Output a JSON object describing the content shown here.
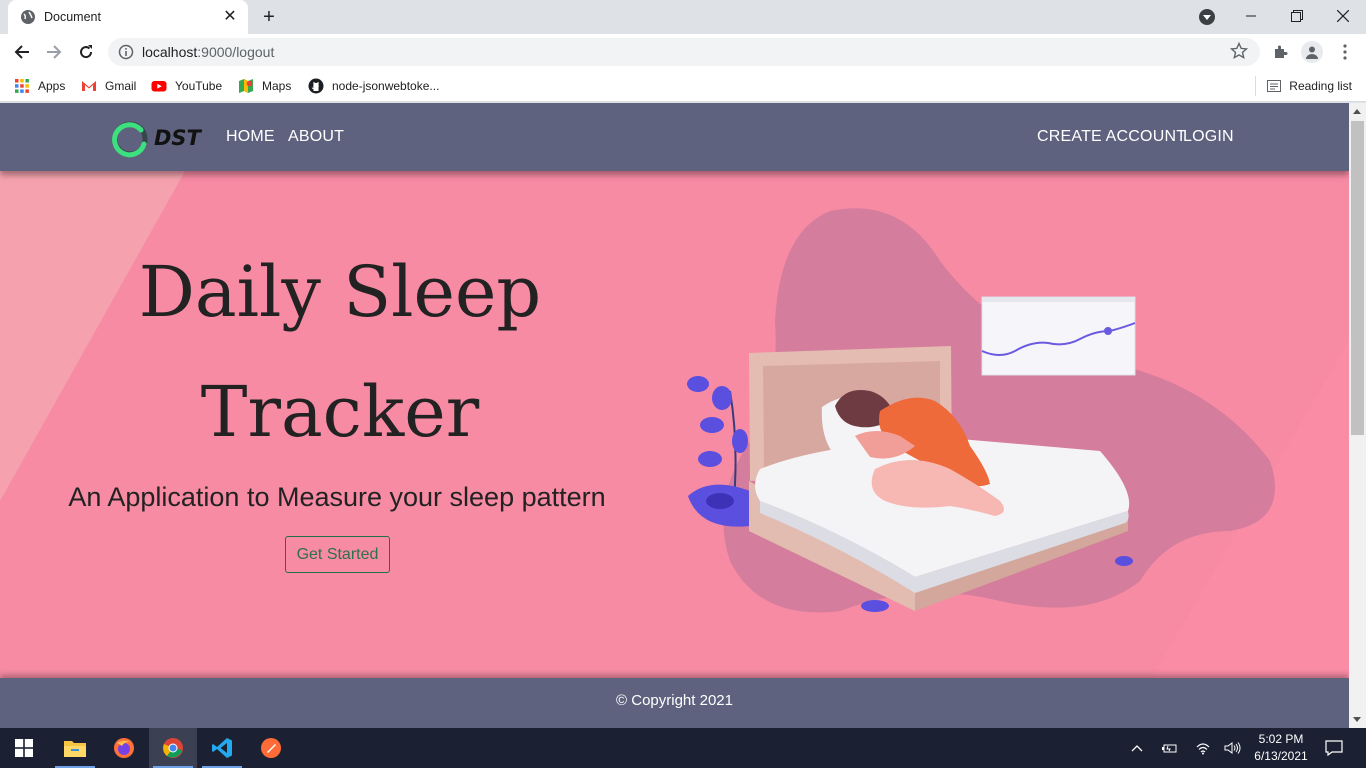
{
  "browser": {
    "tab_title": "Document",
    "url_host": "localhost",
    "url_path": ":9000/logout",
    "bookmarks": [
      {
        "label": "Apps",
        "icon": "apps-grid-icon"
      },
      {
        "label": "Gmail",
        "icon": "gmail-icon"
      },
      {
        "label": "YouTube",
        "icon": "youtube-icon"
      },
      {
        "label": "Maps",
        "icon": "maps-icon"
      },
      {
        "label": "node-jsonwebtoke...",
        "icon": "github-icon"
      }
    ],
    "reading_list": "Reading list"
  },
  "page": {
    "brand": "DST",
    "nav_left": [
      "HOME",
      "ABOUT"
    ],
    "nav_right": [
      "CREATE ACCOUNT",
      "LOGIN"
    ],
    "hero": {
      "title_line1": "Daily Sleep",
      "title_line2": "Tracker",
      "subtitle": "An Application to Measure your sleep pattern",
      "cta": "Get Started"
    },
    "footer": "© Copyright 2021"
  },
  "taskbar": {
    "time": "5:02 PM",
    "date": "6/13/2021",
    "apps": [
      "file-explorer-icon",
      "firefox-icon",
      "chrome-icon",
      "vscode-icon",
      "postman-icon"
    ]
  },
  "colors": {
    "navbar": "#5f627e",
    "hero": "#f78ba4",
    "button_border": "#1f6f48",
    "brand_ring": "#3de07e"
  }
}
